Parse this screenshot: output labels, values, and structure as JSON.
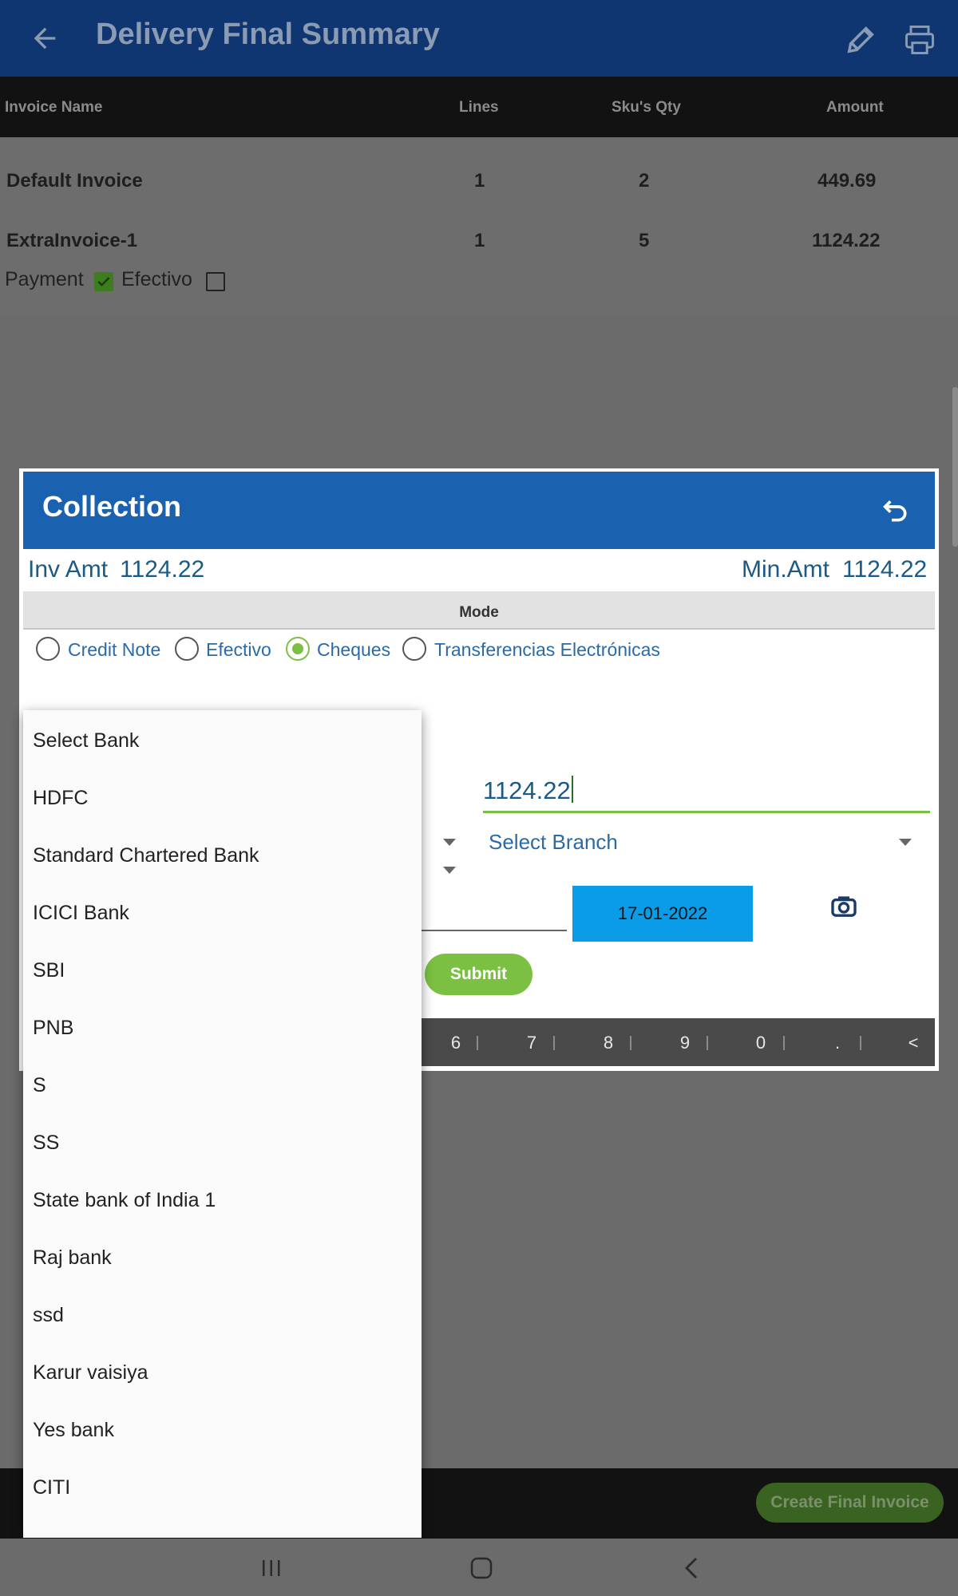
{
  "appbar": {
    "title": "Delivery Final Summary"
  },
  "table": {
    "headers": [
      "Invoice Name",
      "Lines",
      "Sku's Qty",
      "Amount"
    ],
    "rows": [
      {
        "name": "Default Invoice",
        "lines": "1",
        "qty": "2",
        "amount": "449.69"
      },
      {
        "name": "ExtraInvoice-1",
        "lines": "1",
        "qty": "5",
        "amount": "1124.22"
      }
    ]
  },
  "payment": {
    "payment_label": "Payment",
    "payment_checked": true,
    "efectivo_label": "Efectivo",
    "efectivo_checked": false
  },
  "dialog": {
    "title": "Collection",
    "inv_amt_label": "Inv Amt",
    "inv_amt": "1124.22",
    "min_amt_label": "Min.Amt",
    "min_amt": "1124.22",
    "mode_label": "Mode",
    "modes": [
      {
        "label": "Credit Note",
        "selected": false
      },
      {
        "label": "Efectivo",
        "selected": false
      },
      {
        "label": "Cheques",
        "selected": true
      },
      {
        "label": "Transferencias Electrónicas",
        "selected": false
      }
    ],
    "amount_value": "1124.22",
    "branch_select": "Select Branch",
    "date": "17-01-2022",
    "submit_label": "Submit",
    "keypad": [
      "6",
      "7",
      "8",
      "9",
      "0",
      ".",
      "<"
    ]
  },
  "bank_dropdown": {
    "items": [
      "Select Bank",
      "HDFC",
      "Standard Chartered Bank",
      "ICICI Bank",
      "SBI",
      "PNB",
      "S",
      "SS",
      "State bank of India 1",
      "Raj bank",
      "ssd",
      "Karur vaisiya",
      "Yes bank",
      "CITI"
    ]
  },
  "bottom": {
    "create_label": "Create Final Invoice"
  },
  "colors": {
    "primary": "#1a61b0",
    "accent": "#7cc043",
    "date_button": "#0a9ce6"
  }
}
